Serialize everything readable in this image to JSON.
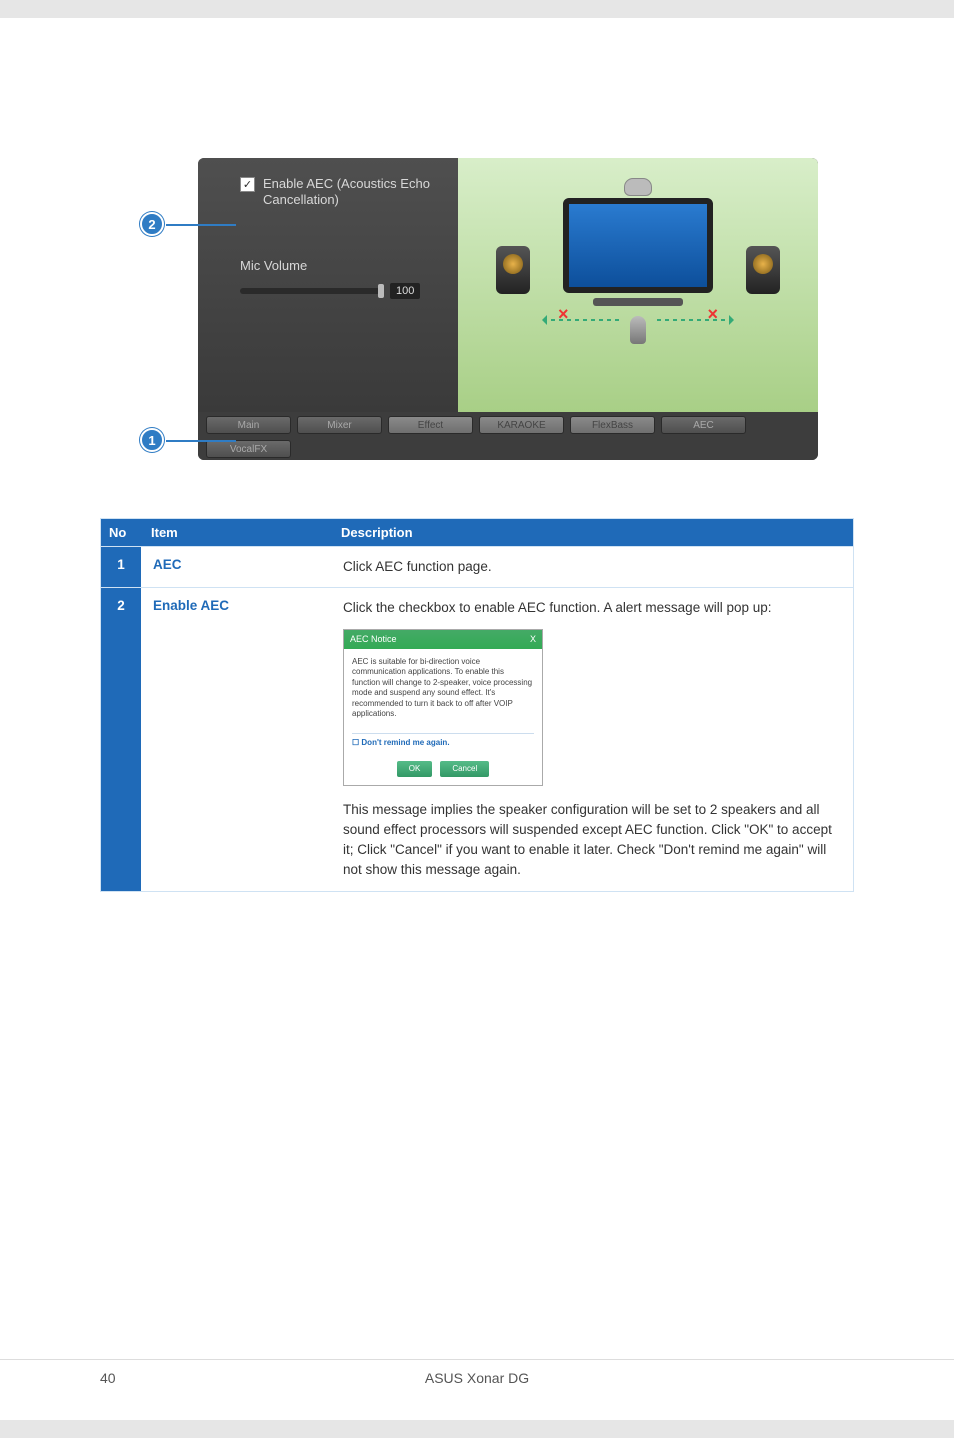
{
  "panel": {
    "enable_aec_label": "Enable AEC (Acoustics Echo Cancellation)",
    "mic_volume_label": "Mic Volume",
    "mic_volume_value": "100"
  },
  "tabs": {
    "main": "Main",
    "mixer": "Mixer",
    "effect": "Effect",
    "karaoke": "KARAOKE",
    "flexbass": "FlexBass",
    "aec": "AEC",
    "vocalfx": "VocalFX"
  },
  "table": {
    "headers": {
      "no": "No",
      "item": "Item",
      "desc": "Description"
    },
    "rows": [
      {
        "no": "1",
        "item": "AEC",
        "desc": "Click AEC function page."
      },
      {
        "no": "2",
        "item": "Enable AEC",
        "desc1": "Click the checkbox to enable AEC function. A alert message will pop up:",
        "dialog": {
          "title": "AEC Notice",
          "body": "AEC is suitable for bi-direction voice communication applications. To enable this function will change to 2-speaker, voice processing mode and suspend any sound effect. It's recommended to turn it back to off after VOIP applications.",
          "remind": "Don't remind me again.",
          "ok": "OK",
          "cancel": "Cancel"
        },
        "desc2": "This message implies the speaker configuration will be set to 2 speakers and all sound effect processors will suspended except AEC function. Click \"OK\" to accept it; Click \"Cancel\" if you want to enable it later. Check \"Don't remind me again\" will not show this message again."
      }
    ]
  },
  "markers": {
    "m1": "1",
    "m2": "2"
  },
  "footer": {
    "product": "ASUS Xonar DG",
    "page": "40"
  }
}
